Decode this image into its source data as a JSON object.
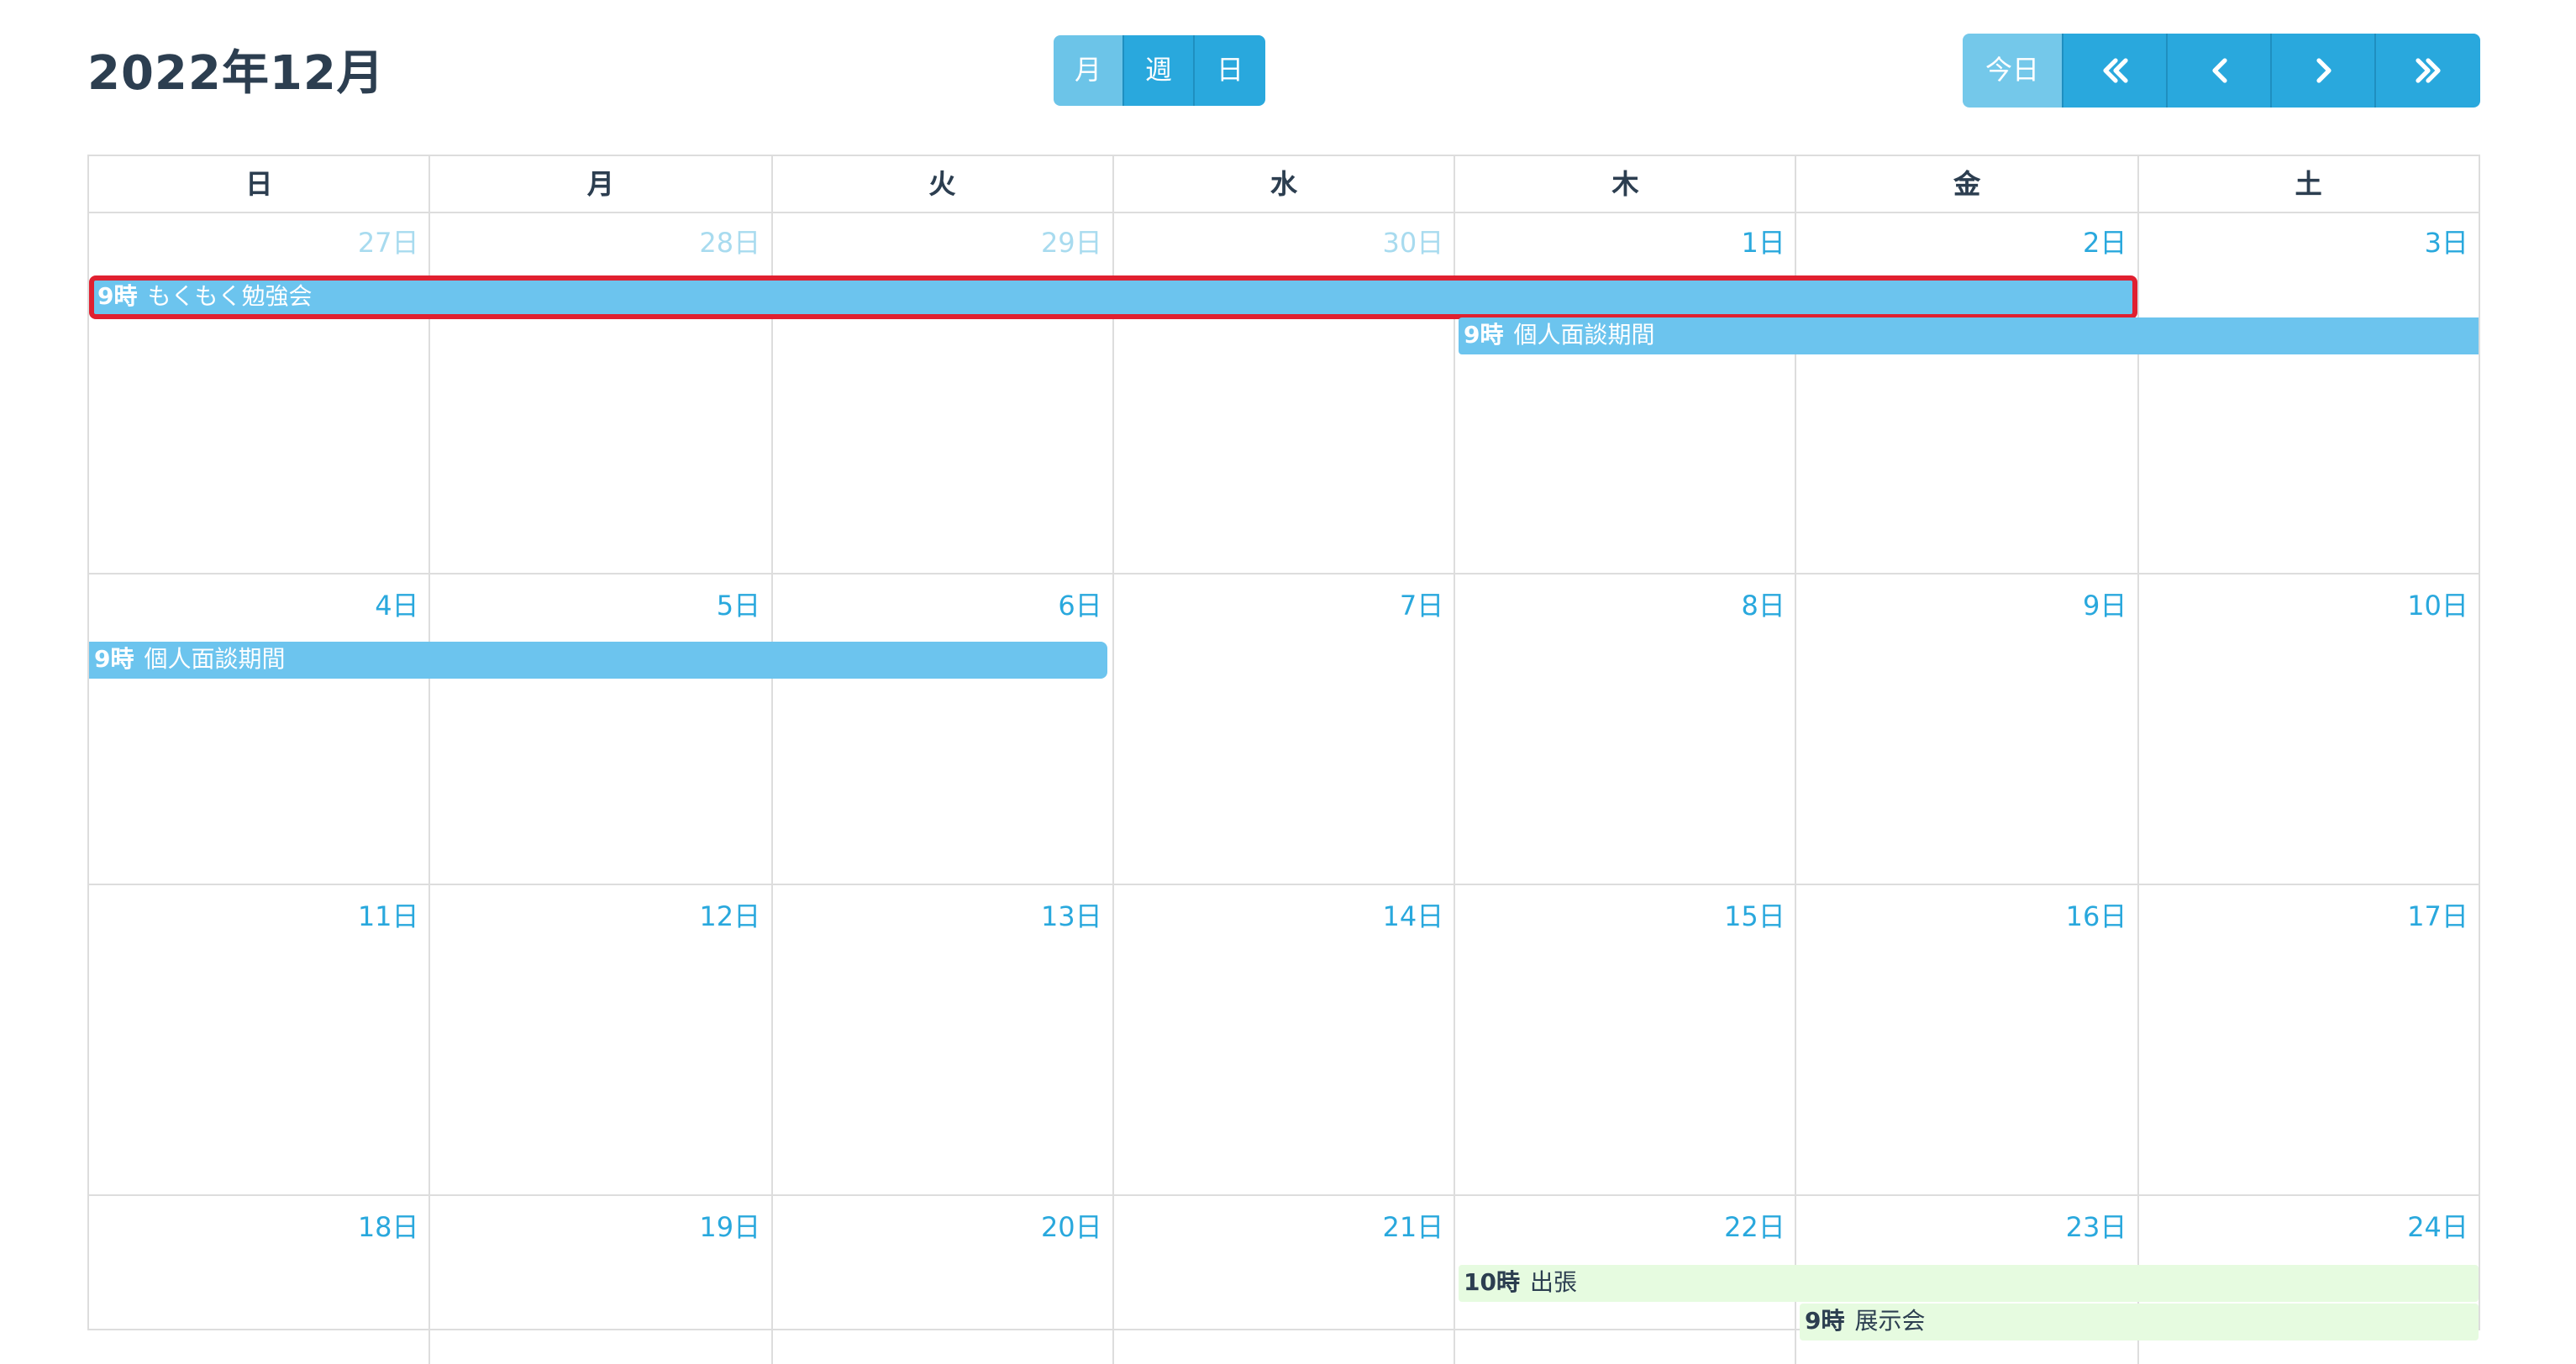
{
  "header": {
    "title": "2022年12月"
  },
  "view_buttons": [
    {
      "label": "月",
      "active": true
    },
    {
      "label": "週",
      "active": false
    },
    {
      "label": "日",
      "active": false
    }
  ],
  "nav": {
    "today_label": "今日",
    "icons": [
      "double-chevron-left-icon",
      "chevron-left-icon",
      "chevron-right-icon",
      "double-chevron-right-icon"
    ]
  },
  "weekdays": [
    "日",
    "月",
    "火",
    "水",
    "木",
    "金",
    "土"
  ],
  "weeks": [
    [
      "27日",
      "28日",
      "29日",
      "30日",
      "1日",
      "2日",
      "3日"
    ],
    [
      "4日",
      "5日",
      "6日",
      "7日",
      "8日",
      "9日",
      "10日"
    ],
    [
      "11日",
      "12日",
      "13日",
      "14日",
      "15日",
      "16日",
      "17日"
    ],
    [
      "18日",
      "19日",
      "20日",
      "21日",
      "22日",
      "23日",
      "24日"
    ]
  ],
  "events": [
    {
      "time": "9時",
      "title": "もくもく勉強会"
    },
    {
      "time": "9時",
      "title": "個人面談期間"
    },
    {
      "time": "9時",
      "title": "個人面談期間"
    },
    {
      "time": "10時",
      "title": "出張"
    },
    {
      "time": "9時",
      "title": "展示会"
    }
  ],
  "colors": {
    "accent": "#29a8dd",
    "accent_light": "#6cc4e8",
    "event_blue": "#6cc4ee",
    "event_green": "#e6fbe0",
    "selection": "#e02030",
    "other_month_day": "#a8dbef"
  }
}
